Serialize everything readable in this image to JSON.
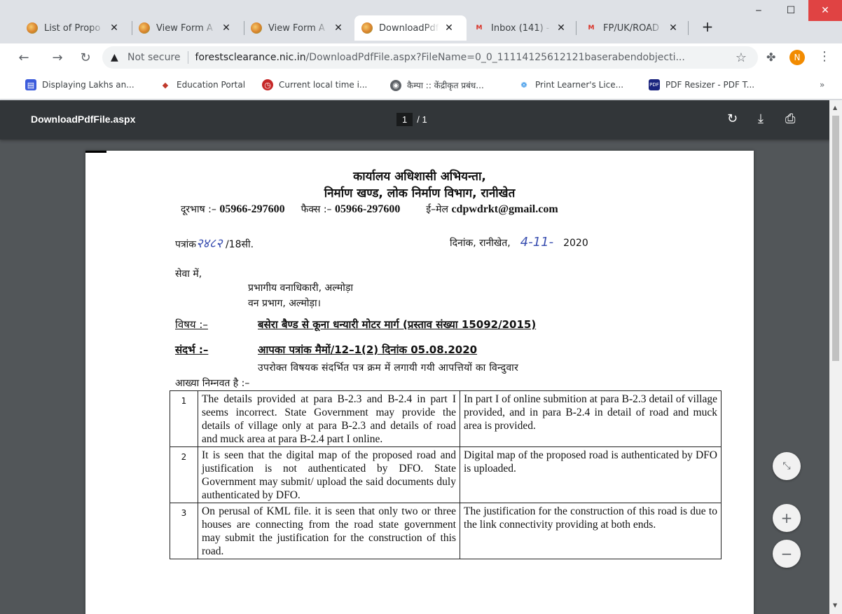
{
  "tabs": [
    {
      "title": "List of Propo",
      "favicon": "forest-clearance-icon",
      "active": false
    },
    {
      "title": "View Form A",
      "favicon": "forest-clearance-icon",
      "active": false
    },
    {
      "title": "View Form A",
      "favicon": "forest-clearance-icon",
      "active": false
    },
    {
      "title": "DownloadPdf",
      "favicon": "forest-clearance-icon",
      "active": true
    },
    {
      "title": "Inbox (141) -",
      "favicon": "gmail-icon",
      "active": false
    },
    {
      "title": "FP/UK/ROAD",
      "favicon": "gmail-icon",
      "active": false
    }
  ],
  "toolbar": {
    "security_label": "Not secure",
    "url_host": "forestsclearance.nic.in",
    "url_path": "/DownloadPdfFile.aspx?FileName=0_0_11114125612121baserabendobjecti...",
    "profile_initial": "N"
  },
  "bookmarks": [
    {
      "label": "Displaying Lakhs an..."
    },
    {
      "label": "Education Portal"
    },
    {
      "label": "Current local time i..."
    },
    {
      "label": "कैम्पा :: केंद्रीकृत प्रबंध..."
    },
    {
      "label": "Print Learner's Lice..."
    },
    {
      "label": "PDF Resizer - PDF T..."
    }
  ],
  "bookmarks_more": "»",
  "pdf_viewer": {
    "title": "DownloadPdfFile.aspx",
    "current_page": "1",
    "total_pages": "/ 1"
  },
  "letter": {
    "office_line1": "कार्यालय अधिशासी अभियन्ता,",
    "office_line2": "निर्माण खण्ड, लोक निर्माण विभाग, रानीखेत",
    "phone_label": "दूरभाष :–",
    "phone": "05966-297600",
    "fax_label": "फैक्स :–",
    "fax": "05966-297600",
    "email_label": "ई–मेल",
    "email": "cdpwdrkt@gmail.com",
    "ref_prefix": "पत्रांक",
    "ref_handwritten": "२४८२",
    "ref_suffix": "/18सी.",
    "date_label": "दिनांक, रानीखेत,",
    "date_handwritten": "4-11-",
    "date_year": "2020",
    "salutation": "सेवा में,",
    "addressee_line1": "प्रभागीय वनाधिकारी, अल्मोड़ा",
    "addressee_line2": "वन प्रभाग, अल्मोड़ा।",
    "subject_label": "विषय :–",
    "subject": "बसेरा बैण्ड से कूना धन्यारी मोटर मार्ग (प्रस्ताव संख्या 15092/2015)",
    "reference_label": "संदर्भ :–",
    "reference": "आपका पत्रांक मैमों/12–1(2) दिनांक 05.08.2020",
    "intro_line1": "उपरोक्त विषयक संदर्भित पत्र क्रम में लगायी गयी आपत्तियों का विन्दुवार",
    "intro_line2": "आख्या निम्नवत है :–",
    "rows": [
      {
        "num": "1",
        "objection": "The details provided at para B-2.3 and B-2.4 in part I seems incorrect. State Government may provide the details of village only at para B-2.3 and details of road and muck area at para B-2.4 part I online.",
        "reply": "In part I of online submition at para B-2.3 detail of village provided, and in para B-2.4 in detail of road and muck area is provided."
      },
      {
        "num": "2",
        "objection": "It is seen that the digital map of the proposed road and justification is not authenticated by DFO. State Government may submit/ upload the said documents duly authenticated by DFO.",
        "reply": "Digital map of the proposed road is authenticated by DFO is uploaded."
      },
      {
        "num": "3",
        "objection": "On perusal of KML file. it is seen that only two or three houses are connecting from the road state government may submit the justification for the construction of this road.",
        "reply": "The justification for the construction of this road is due to the link connectivity providing at both ends."
      }
    ]
  },
  "colors": {
    "tabstrip": "#dee1e6",
    "pdf_toolbar": "#323639",
    "pdf_background": "#525659",
    "handwriting": "#3a4fb0",
    "close_button": "#e04343"
  }
}
